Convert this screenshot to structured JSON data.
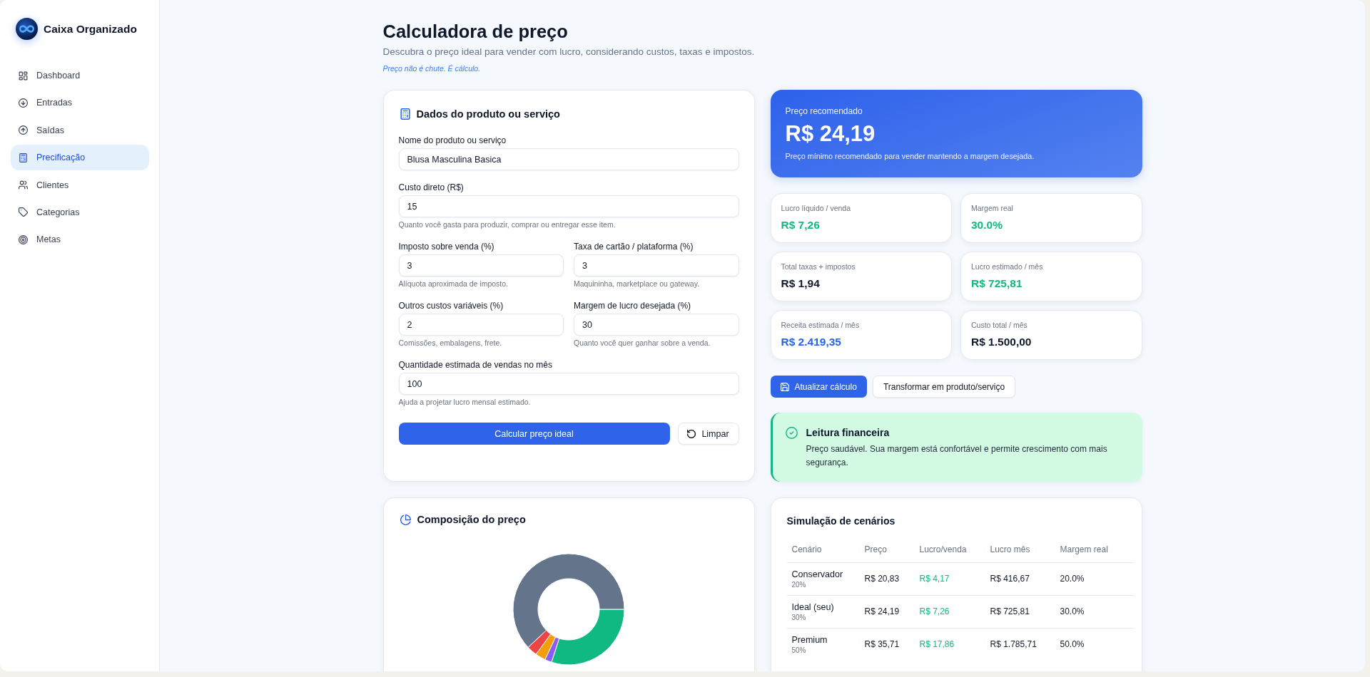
{
  "sidebar": {
    "brand": "Caixa Organizado",
    "items": [
      {
        "label": "Dashboard",
        "selected": false
      },
      {
        "label": "Entradas",
        "selected": false
      },
      {
        "label": "Saídas",
        "selected": false
      },
      {
        "label": "Precificação",
        "selected": true
      },
      {
        "label": "Clientes",
        "selected": false
      },
      {
        "label": "Categorias",
        "selected": false
      },
      {
        "label": "Metas",
        "selected": false
      }
    ]
  },
  "header": {
    "title": "Calculadora de preço",
    "subtitle": "Descubra o preço ideal para vender com lucro, considerando custos, taxas e impostos.",
    "tagline": "Preço não é chute. É cálculo."
  },
  "form": {
    "title": "Dados do produto ou serviço",
    "rows": [
      [
        {
          "label": "Nome do produto ou serviço",
          "value": "Blusa Masculina Basica"
        }
      ],
      [
        {
          "label": "Custo direto (R$)",
          "value": "15",
          "hint": "Quanto você gasta para produzir, comprar ou entregar esse item."
        }
      ],
      [
        {
          "label": "Imposto sobre venda (%)",
          "value": "3",
          "hint": "Alíquota aproximada de imposto."
        },
        {
          "label": "Taxa de cartão / plataforma (%)",
          "value": "3",
          "hint": "Maquininha, marketplace ou gateway."
        }
      ],
      [
        {
          "label": "Outros custos variáveis (%)",
          "value": "2",
          "hint": "Comissões, embalagens, frete."
        },
        {
          "label": "Margem de lucro desejada (%)",
          "value": "30",
          "hint": "Quanto você quer ganhar sobre a venda."
        }
      ],
      [
        {
          "label": "Quantidade estimada de vendas no mês",
          "value": "100",
          "hint": "Ajuda a projetar lucro mensal estimado."
        }
      ]
    ],
    "buttons": [
      {
        "label": "Calcular preço ideal",
        "kind": "primary"
      },
      {
        "label": "Limpar",
        "kind": "secondary"
      }
    ]
  },
  "recommended": {
    "label": "Preço recomendado",
    "value": "R$ 24,19",
    "note": "Preço mínimo recomendado para vender mantendo a margem desejada."
  },
  "stats": [
    {
      "label": "Lucro líquido / venda",
      "value": "R$ 7,26",
      "color": "#10b981"
    },
    {
      "label": "Margem real",
      "value": "30.0%",
      "color": "#10b981"
    },
    {
      "label": "Total taxas + impostos",
      "value": "R$ 1,94",
      "color": "#0f172a"
    },
    {
      "label": "Lucro estimado / mês",
      "value": "R$ 725,81",
      "color": "#10b981"
    },
    {
      "label": "Receita estimada / mês",
      "value": "R$ 2.419,35",
      "color": "#2563eb"
    },
    {
      "label": "Custo total / mês",
      "value": "R$ 1.500,00",
      "color": "#0f172a"
    }
  ],
  "actions": [
    {
      "label": "Atualizar cálculo",
      "kind": "primary"
    },
    {
      "label": "Transformar em produto/serviço",
      "kind": "secondary"
    }
  ],
  "insight": {
    "title": "Leitura financeira",
    "text": "Preço saudável. Sua margem está confortável e permite crescimento com mais segurança."
  },
  "composition": {
    "title": "Composição do preço"
  },
  "scenarios": {
    "title": "Simulação de cenários",
    "columns": [
      "Cenário",
      "Preço",
      "Lucro/venda",
      "Lucro mês",
      "Margem real"
    ],
    "rows": [
      {
        "cells": [
          {
            "text": "Conservador",
            "note": "20%"
          },
          {
            "text": "R$ 20,83"
          },
          {
            "text": "R$ 4,17"
          },
          {
            "text": "R$ 416,67"
          },
          {
            "text": "20.0%"
          }
        ]
      },
      {
        "cells": [
          {
            "text": "Ideal (seu)",
            "note": "30%"
          },
          {
            "text": "R$ 24,19"
          },
          {
            "text": "R$ 7,26"
          },
          {
            "text": "R$ 725,81"
          },
          {
            "text": "30.0%"
          }
        ]
      },
      {
        "cells": [
          {
            "text": "Premium",
            "note": "50%"
          },
          {
            "text": "R$ 35,71"
          },
          {
            "text": "R$ 17,86"
          },
          {
            "text": "R$ 1.785,71"
          },
          {
            "text": "50.0%"
          }
        ]
      }
    ]
  }
}
